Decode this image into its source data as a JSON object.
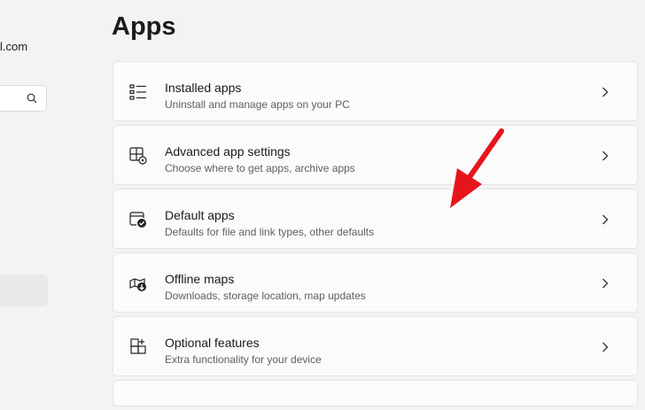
{
  "sidebar": {
    "email_fragment": "l.com",
    "search_icon": "search-icon"
  },
  "page": {
    "title": "Apps"
  },
  "items": [
    {
      "title": "Installed apps",
      "subtitle": "Uninstall and manage apps on your PC",
      "icon": "list-icon"
    },
    {
      "title": "Advanced app settings",
      "subtitle": "Choose where to get apps, archive apps",
      "icon": "app-settings-icon"
    },
    {
      "title": "Default apps",
      "subtitle": "Defaults for file and link types, other defaults",
      "icon": "default-apps-icon"
    },
    {
      "title": "Offline maps",
      "subtitle": "Downloads, storage location, map updates",
      "icon": "map-icon"
    },
    {
      "title": "Optional features",
      "subtitle": "Extra functionality for your device",
      "icon": "optional-features-icon"
    }
  ],
  "colors": {
    "background": "#f3f3f3",
    "card": "#fbfbfb",
    "annotation_arrow": "#e8141c"
  }
}
